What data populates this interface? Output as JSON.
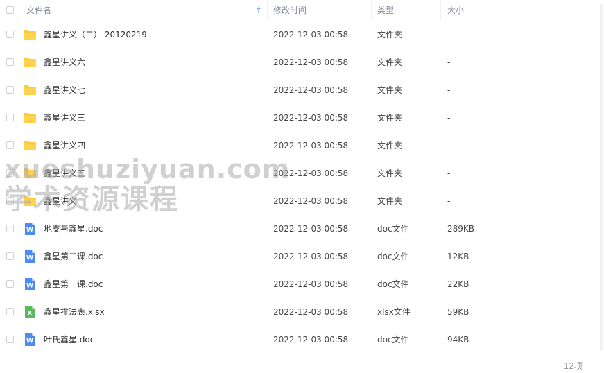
{
  "header": {
    "col_name": "文件名",
    "col_time": "修改时间",
    "col_type": "类型",
    "col_size": "大小"
  },
  "rows": [
    {
      "name": "鑫星讲义（二） 20120219",
      "time": "2022-12-03 00:58",
      "type": "文件夹",
      "size": "-",
      "icon": "folder-icon"
    },
    {
      "name": "鑫星讲义六",
      "time": "2022-12-03 00:58",
      "type": "文件夹",
      "size": "-",
      "icon": "folder-icon"
    },
    {
      "name": "鑫星讲义七",
      "time": "2022-12-03 00:58",
      "type": "文件夹",
      "size": "-",
      "icon": "folder-icon"
    },
    {
      "name": "鑫星讲义三",
      "time": "2022-12-03 00:58",
      "type": "文件夹",
      "size": "-",
      "icon": "folder-icon"
    },
    {
      "name": "鑫星讲义四",
      "time": "2022-12-03 00:58",
      "type": "文件夹",
      "size": "-",
      "icon": "folder-icon"
    },
    {
      "name": "鑫星讲义五",
      "time": "2022-12-03 00:58",
      "type": "文件夹",
      "size": "-",
      "icon": "folder-icon"
    },
    {
      "name": "鑫星讲义",
      "time": "2022-12-03 00:58",
      "type": "文件夹",
      "size": "-",
      "icon": "folder-icon"
    },
    {
      "name": "地支与鑫星.doc",
      "time": "2022-12-03 00:58",
      "type": "doc文件",
      "size": "289KB",
      "icon": "word-doc-icon"
    },
    {
      "name": "鑫星第二课.doc",
      "time": "2022-12-03 00:58",
      "type": "doc文件",
      "size": "12KB",
      "icon": "word-doc-icon"
    },
    {
      "name": "鑫星第一课.doc",
      "time": "2022-12-03 00:58",
      "type": "doc文件",
      "size": "22KB",
      "icon": "word-doc-icon"
    },
    {
      "name": "鑫星排法表.xlsx",
      "time": "2022-12-03 00:58",
      "type": "xlsx文件",
      "size": "59KB",
      "icon": "excel-xlsx-icon"
    },
    {
      "name": "叶氏鑫星.doc",
      "time": "2022-12-03 00:58",
      "type": "doc文件",
      "size": "94KB",
      "icon": "word-doc-icon"
    }
  ],
  "footer": {
    "count": "12项"
  },
  "watermark": {
    "line1": "xueshuziyuan.com",
    "line2": "学术资源课程"
  },
  "colors": {
    "folder": "#ffcb3d",
    "word": "#4a8cf0",
    "excel": "#5cb85c",
    "sort_arrow": "#3b8cff"
  }
}
